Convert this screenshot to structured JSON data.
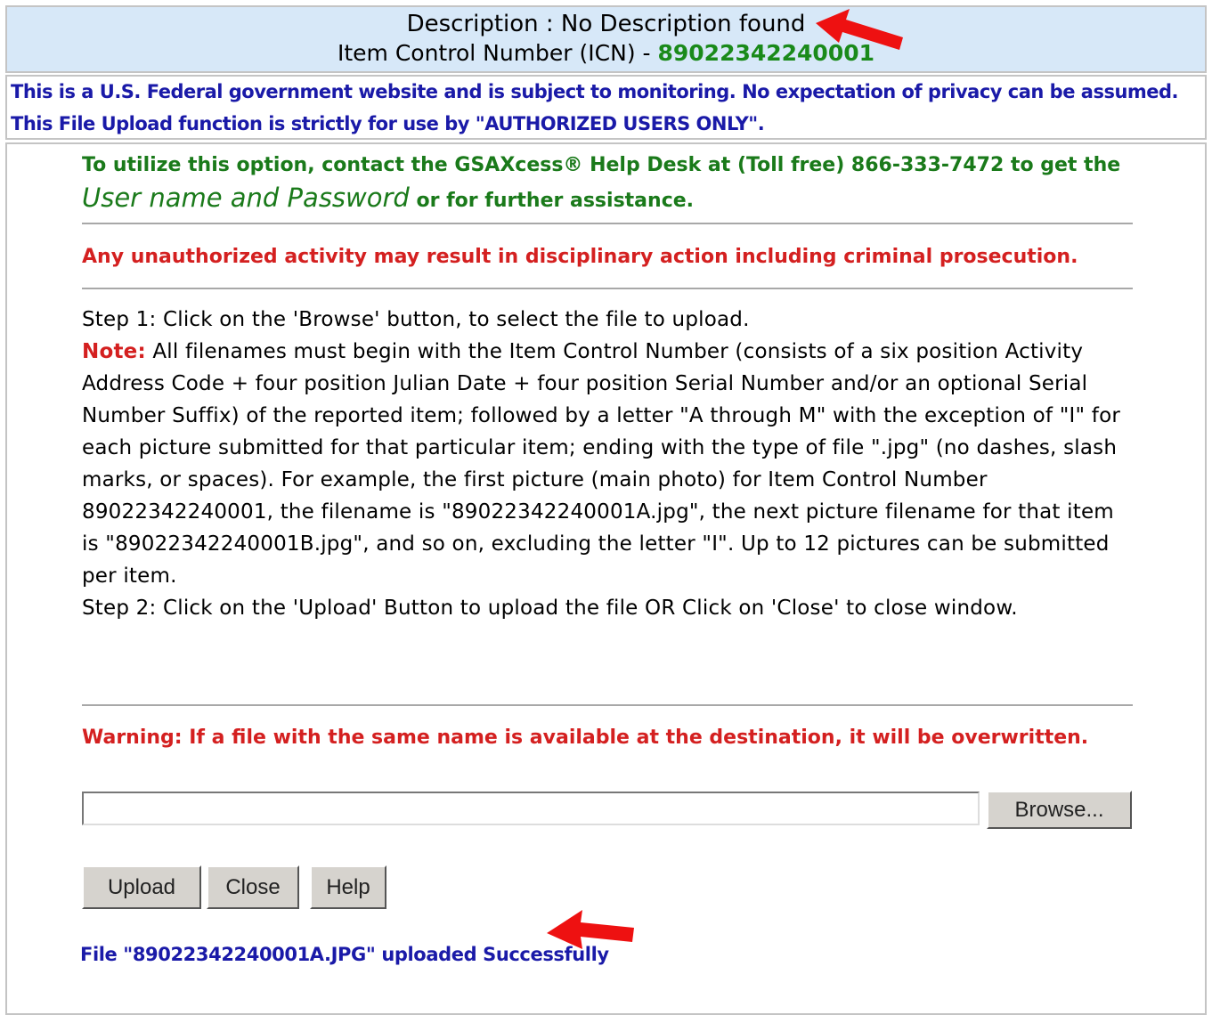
{
  "header": {
    "description_label": "Description : No Description found",
    "icn_label": "Item Control Number (ICN) - ",
    "icn_value": "89022342240001"
  },
  "notice": {
    "line1": "This is a U.S. Federal government website and is subject to monitoring. No expectation of privacy can be assumed.",
    "line2": "This File Upload function is strictly for use by \"AUTHORIZED USERS ONLY\"."
  },
  "contact": {
    "line1": "To utilize this option, contact the GSAXcess® Help Desk at (Toll free) 866-333-7472 to get the",
    "credentials": "User name and Password",
    "line2_rest": " or for further assistance."
  },
  "unauthorized_warning": "Any unauthorized activity may result in disciplinary action including criminal prosecution.",
  "instructions": {
    "step1": "Step 1: Click on the 'Browse' button, to select the file to upload.",
    "note_label": "Note:",
    "note_text": " All filenames must begin with the Item Control Number (consists of a six position Activity Address Code + four position Julian Date + four position Serial Number and/or an optional Serial Number Suffix) of the reported item; followed by a letter \"A through M\" with the exception of \"I\" for each picture submitted for that particular item; ending with the type of file \".jpg\" (no dashes, slash marks, or spaces). For example, the first picture (main photo) for Item Control Number 89022342240001, the filename is \"89022342240001A.jpg\", the next picture filename for that item is \"89022342240001B.jpg\", and so on, excluding the letter \"I\". Up to 12 pictures can be submitted per item.",
    "step2": "Step 2: Click on the 'Upload' Button to upload the file OR Click on 'Close' to close window."
  },
  "overwrite_warning": "Warning: If a file with the same name is available at the destination, it will be overwritten.",
  "file_input": {
    "value": ""
  },
  "buttons": {
    "browse": "Browse...",
    "upload": "Upload",
    "close": "Close",
    "help": "Help"
  },
  "status_message": "File \"89022342240001A.JPG\" uploaded Successfully",
  "colors": {
    "header_bg": "#d7e8f8",
    "icn_green": "#1a8a1a",
    "notice_blue": "#1a1aa8",
    "warning_red": "#d42020",
    "annotation_arrow": "#ee1111"
  },
  "annotations": [
    {
      "icon": "red-arrow-icon",
      "points_at": "description"
    },
    {
      "icon": "red-arrow-icon",
      "points_at": "status-message"
    }
  ]
}
